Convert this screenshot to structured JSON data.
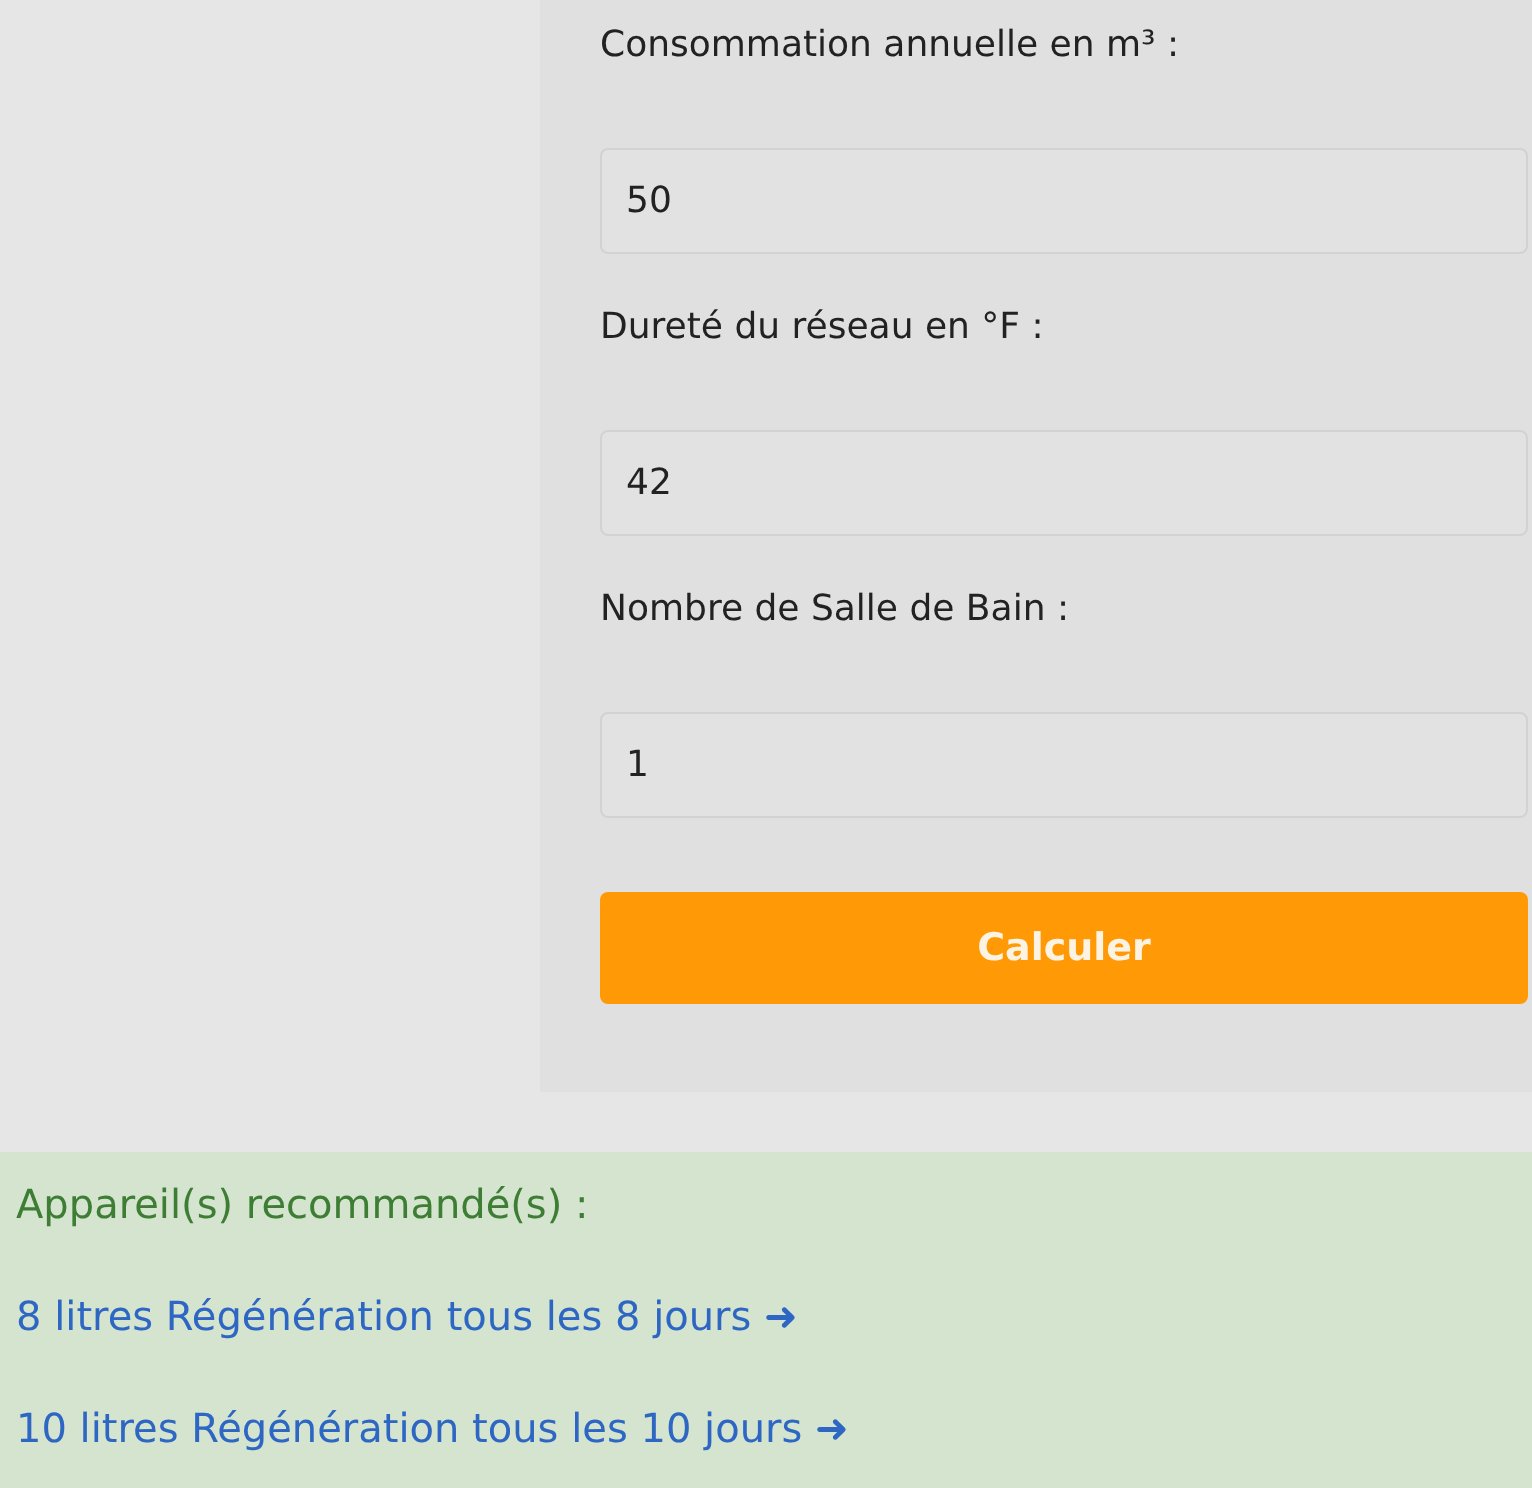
{
  "form": {
    "fields": [
      {
        "label": "Consommation annuelle en m³ :",
        "value": "50"
      },
      {
        "label": "Dureté du réseau en °F :",
        "value": "42"
      },
      {
        "label": "Nombre de Salle de Bain :",
        "value": "1"
      }
    ],
    "button": "Calculer"
  },
  "results": {
    "heading": "Appareil(s) recommandé(s) :",
    "links": [
      "8 litres Régénération tous les 8 jours ➜",
      "10 litres Régénération tous les 10 jours ➜"
    ]
  }
}
